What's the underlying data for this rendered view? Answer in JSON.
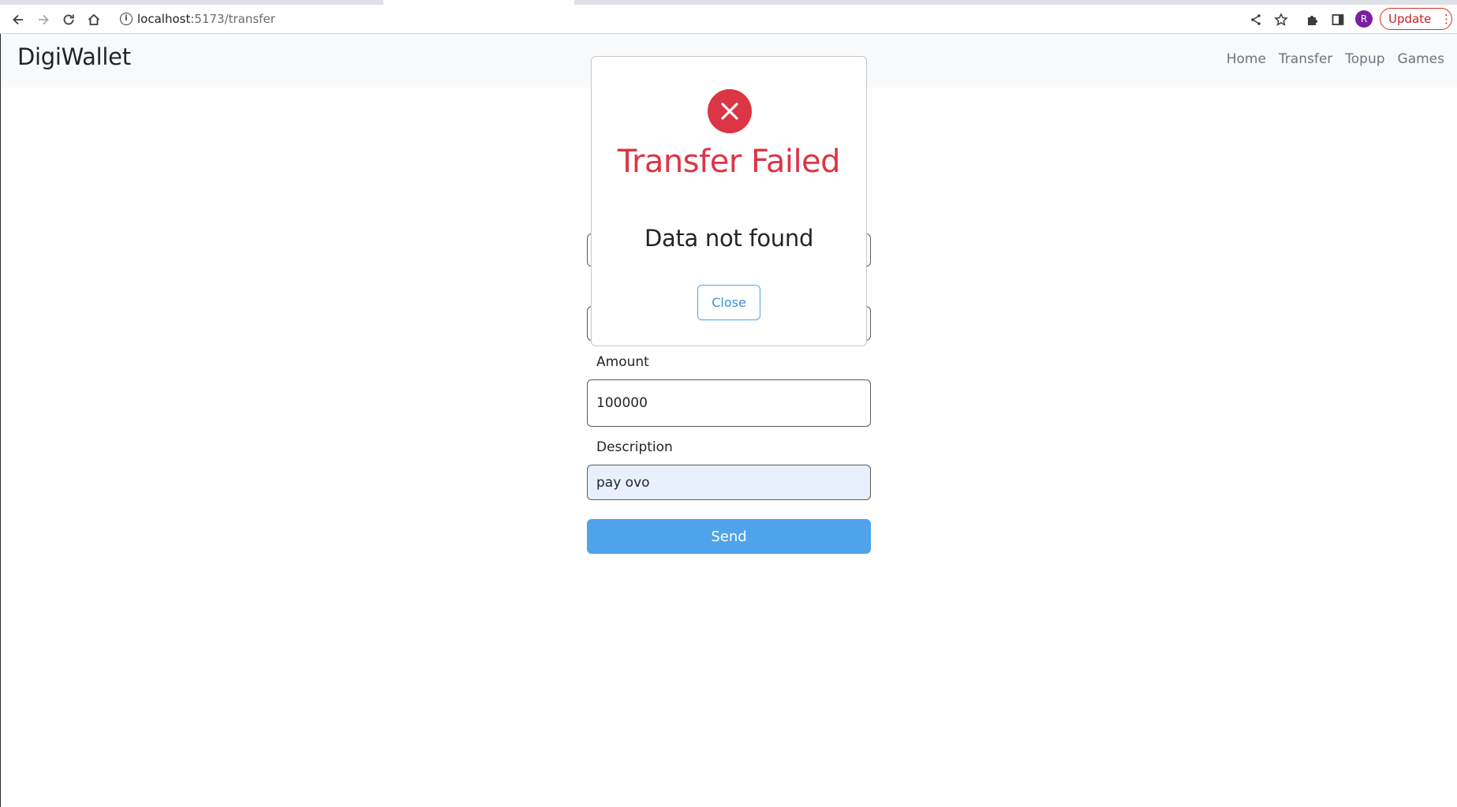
{
  "browser": {
    "url_host": "localhost",
    "url_rest": ":5173/transfer",
    "profile_initial": "R",
    "update_label": "Update",
    "menu_glyph": "⋮"
  },
  "icons": {
    "back": "arrow-left-icon",
    "forward": "arrow-right-icon",
    "reload": "reload-icon",
    "home": "home-icon",
    "info": "info-icon",
    "share": "share-icon",
    "star": "star-icon",
    "extensions": "puzzle-icon",
    "side_panel": "side-panel-icon",
    "error": "x-circle-icon"
  },
  "navbar": {
    "brand": "DigiWallet",
    "links": [
      "Home",
      "Transfer",
      "Topup",
      "Games"
    ]
  },
  "form": {
    "amount_label": "Amount",
    "amount_value": "100000",
    "description_label": "Description",
    "description_value": "pay ovo",
    "send_label": "Send"
  },
  "modal": {
    "title": "Transfer Failed",
    "message": "Data not found",
    "close_label": "Close"
  },
  "colors": {
    "error": "#dc3545",
    "primary": "#4fa3ea",
    "navbar_bg": "#f8f9fa",
    "autofill_bg": "#e8f0fe"
  }
}
